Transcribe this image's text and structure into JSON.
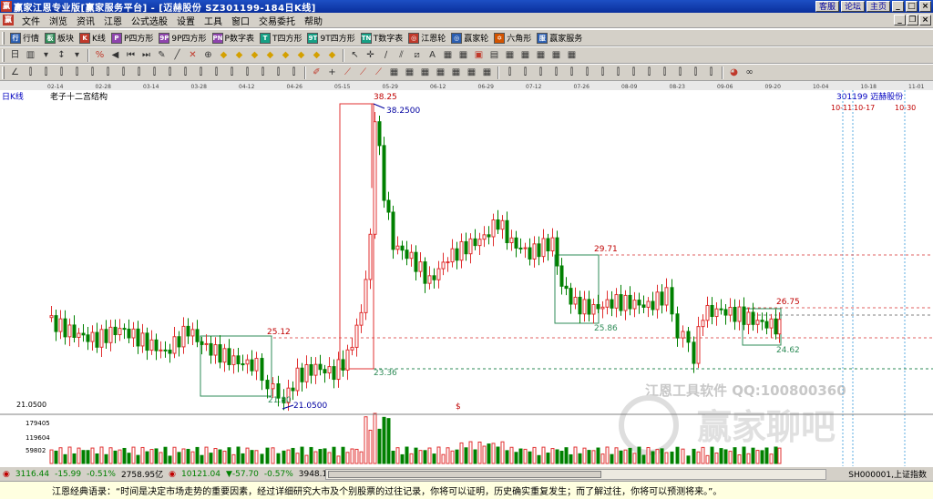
{
  "window": {
    "title": "赢家江恩专业版[赢家服务平台] - [迈赫股份   SZ301199-184日K线]",
    "title_buttons": [
      "客服",
      "论坛",
      "主页"
    ]
  },
  "menu": [
    "文件",
    "浏览",
    "资讯",
    "江恩",
    "公式选股",
    "设置",
    "工具",
    "窗口",
    "交易委托",
    "帮助"
  ],
  "toolbar1": [
    {
      "label": "行情",
      "icon": "quote-icon",
      "color": "#2a5db0",
      "glyph": "行"
    },
    {
      "label": "板块",
      "icon": "sector-icon",
      "color": "#2e8b57",
      "glyph": "板"
    },
    {
      "label": "K线",
      "icon": "kline-icon",
      "color": "#c0392b",
      "glyph": "K"
    },
    {
      "label": "P四方形",
      "icon": "p-square-icon",
      "color": "#8e44ad",
      "glyph": "P"
    },
    {
      "label": "9P四方形",
      "icon": "9p-square-icon",
      "color": "#8e44ad",
      "glyph": "9P"
    },
    {
      "label": "P数字表",
      "icon": "p-table-icon",
      "color": "#8e44ad",
      "glyph": "PN"
    },
    {
      "label": "T四方形",
      "icon": "t-square-icon",
      "color": "#16a085",
      "glyph": "T"
    },
    {
      "label": "9T四方形",
      "icon": "9t-square-icon",
      "color": "#16a085",
      "glyph": "9T"
    },
    {
      "label": "T数字表",
      "icon": "t-table-icon",
      "color": "#16a085",
      "glyph": "TN"
    },
    {
      "label": "江恩轮",
      "icon": "gann-wheel-icon",
      "color": "#c0392b",
      "glyph": "◎"
    },
    {
      "label": "赢家轮",
      "icon": "winner-wheel-icon",
      "color": "#2a5db0",
      "glyph": "◎"
    },
    {
      "label": "六角形",
      "icon": "hexagon-icon",
      "color": "#d35400",
      "glyph": "✡"
    },
    {
      "label": "赢家服务",
      "icon": "service-icon",
      "color": "#2a5db0",
      "glyph": "服"
    }
  ],
  "chart": {
    "period_label": "日K线",
    "structure_label": "老子十二宫结构",
    "stock_label": "301199  迈赫股份",
    "watermark_main": "江恩工具软件  QQ:100800360",
    "watermark_brand": "赢家聊吧",
    "dates": [
      "02-14",
      "02-28",
      "03-14",
      "03-28",
      "04-12",
      "04-26",
      "05-15",
      "05-29",
      "06-12",
      "06-29",
      "07-12",
      "07-26",
      "08-09",
      "08-23",
      "09-06",
      "09-20",
      "10-04",
      "10-18",
      "11-01"
    ],
    "date_markers": [
      "10-11",
      "10-17",
      "10-30"
    ],
    "price_labels": [
      "38.25",
      "38.2500",
      "29.71",
      "26.75",
      "25.86",
      "25.12",
      "24.62",
      "23.36",
      "21.80",
      "21.0500",
      "21.0500"
    ],
    "volume_labels": [
      "179405",
      "119604",
      "59802"
    ]
  },
  "chart_data": {
    "type": "candlestick",
    "title": "迈赫股份 日K线",
    "annotations": [
      {
        "label": "38.25",
        "value": 38.25
      },
      {
        "label": "29.71",
        "value": 29.71
      },
      {
        "label": "26.75",
        "value": 26.75
      },
      {
        "label": "25.86",
        "value": 25.86
      },
      {
        "label": "25.12",
        "value": 25.12
      },
      {
        "label": "24.62",
        "value": 24.62
      },
      {
        "label": "23.36",
        "value": 23.36
      },
      {
        "label": "21.80",
        "value": 21.8
      },
      {
        "label": "21.0500",
        "value": 21.05
      }
    ],
    "ylim": [
      20.5,
      39
    ],
    "volume_ticks": [
      59802,
      119604,
      179405
    ]
  },
  "status": {
    "sh_index": "3116.44",
    "sh_change": "-15.99",
    "sh_pct": "-0.51%",
    "sh_amount": "2758.95亿",
    "sz_index": "10121.04",
    "sz_change": "▼-57.70",
    "sz_pct": "-0.57%",
    "sz_amount": "3948.1",
    "right_code": "SH000001,上证指数"
  },
  "quote": "江恩经典语录：“时间是决定市场走势的重要因素，经过详细研究大市及个别股票的过往记录，你将可以证明，历史确实重复发生；而了解过往，你将可以预测将来。”。"
}
